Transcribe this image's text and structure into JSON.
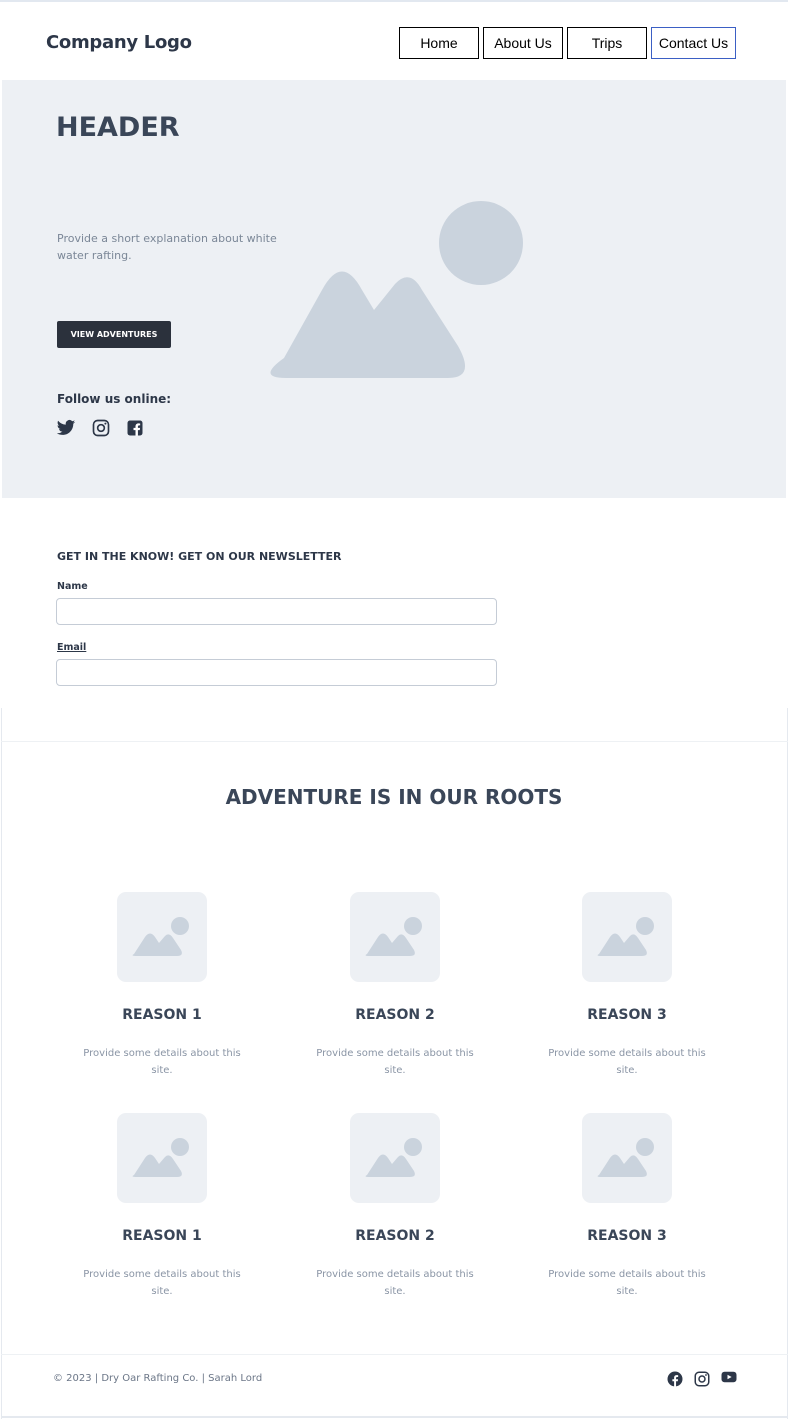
{
  "header": {
    "logo": "Company Logo",
    "nav": [
      "Home",
      "About Us",
      "Trips",
      "Contact Us"
    ]
  },
  "hero": {
    "title": "HEADER",
    "description": "Provide a short explanation about white water rafting.",
    "button_label": "VIEW ADVENTURES",
    "follow_label": "Follow us online:",
    "social_icons": [
      "twitter-icon",
      "instagram-icon",
      "facebook-icon"
    ]
  },
  "newsletter": {
    "title": "GET IN THE KNOW! GET ON OUR NEWSLETTER",
    "name_label": "Name",
    "name_value": "",
    "email_label": "Email",
    "email_value": ""
  },
  "features": {
    "title": "ADVENTURE IS IN OUR ROOTS",
    "cards": [
      {
        "title": "REASON 1",
        "text": "Provide some details about this site."
      },
      {
        "title": "REASON 2",
        "text": "Provide some details about this site."
      },
      {
        "title": "REASON 3",
        "text": "Provide some details about this site."
      },
      {
        "title": "REASON 1",
        "text": "Provide some details about this site."
      },
      {
        "title": "REASON 2",
        "text": "Provide some details about this site."
      },
      {
        "title": "REASON 3",
        "text": "Provide some details about this site."
      }
    ]
  },
  "footer": {
    "copyright": "© 2023 | Dry Oar Rafting Co. | Sarah Lord",
    "icons": [
      "facebook-icon",
      "instagram-icon",
      "youtube-icon"
    ]
  },
  "colors": {
    "hero_bg": "#edf0f4",
    "placeholder_shape": "#cad3dd",
    "dark_button": "#2b313c",
    "heading": "#3a4658",
    "active_nav_border": "#3b5fc4"
  }
}
